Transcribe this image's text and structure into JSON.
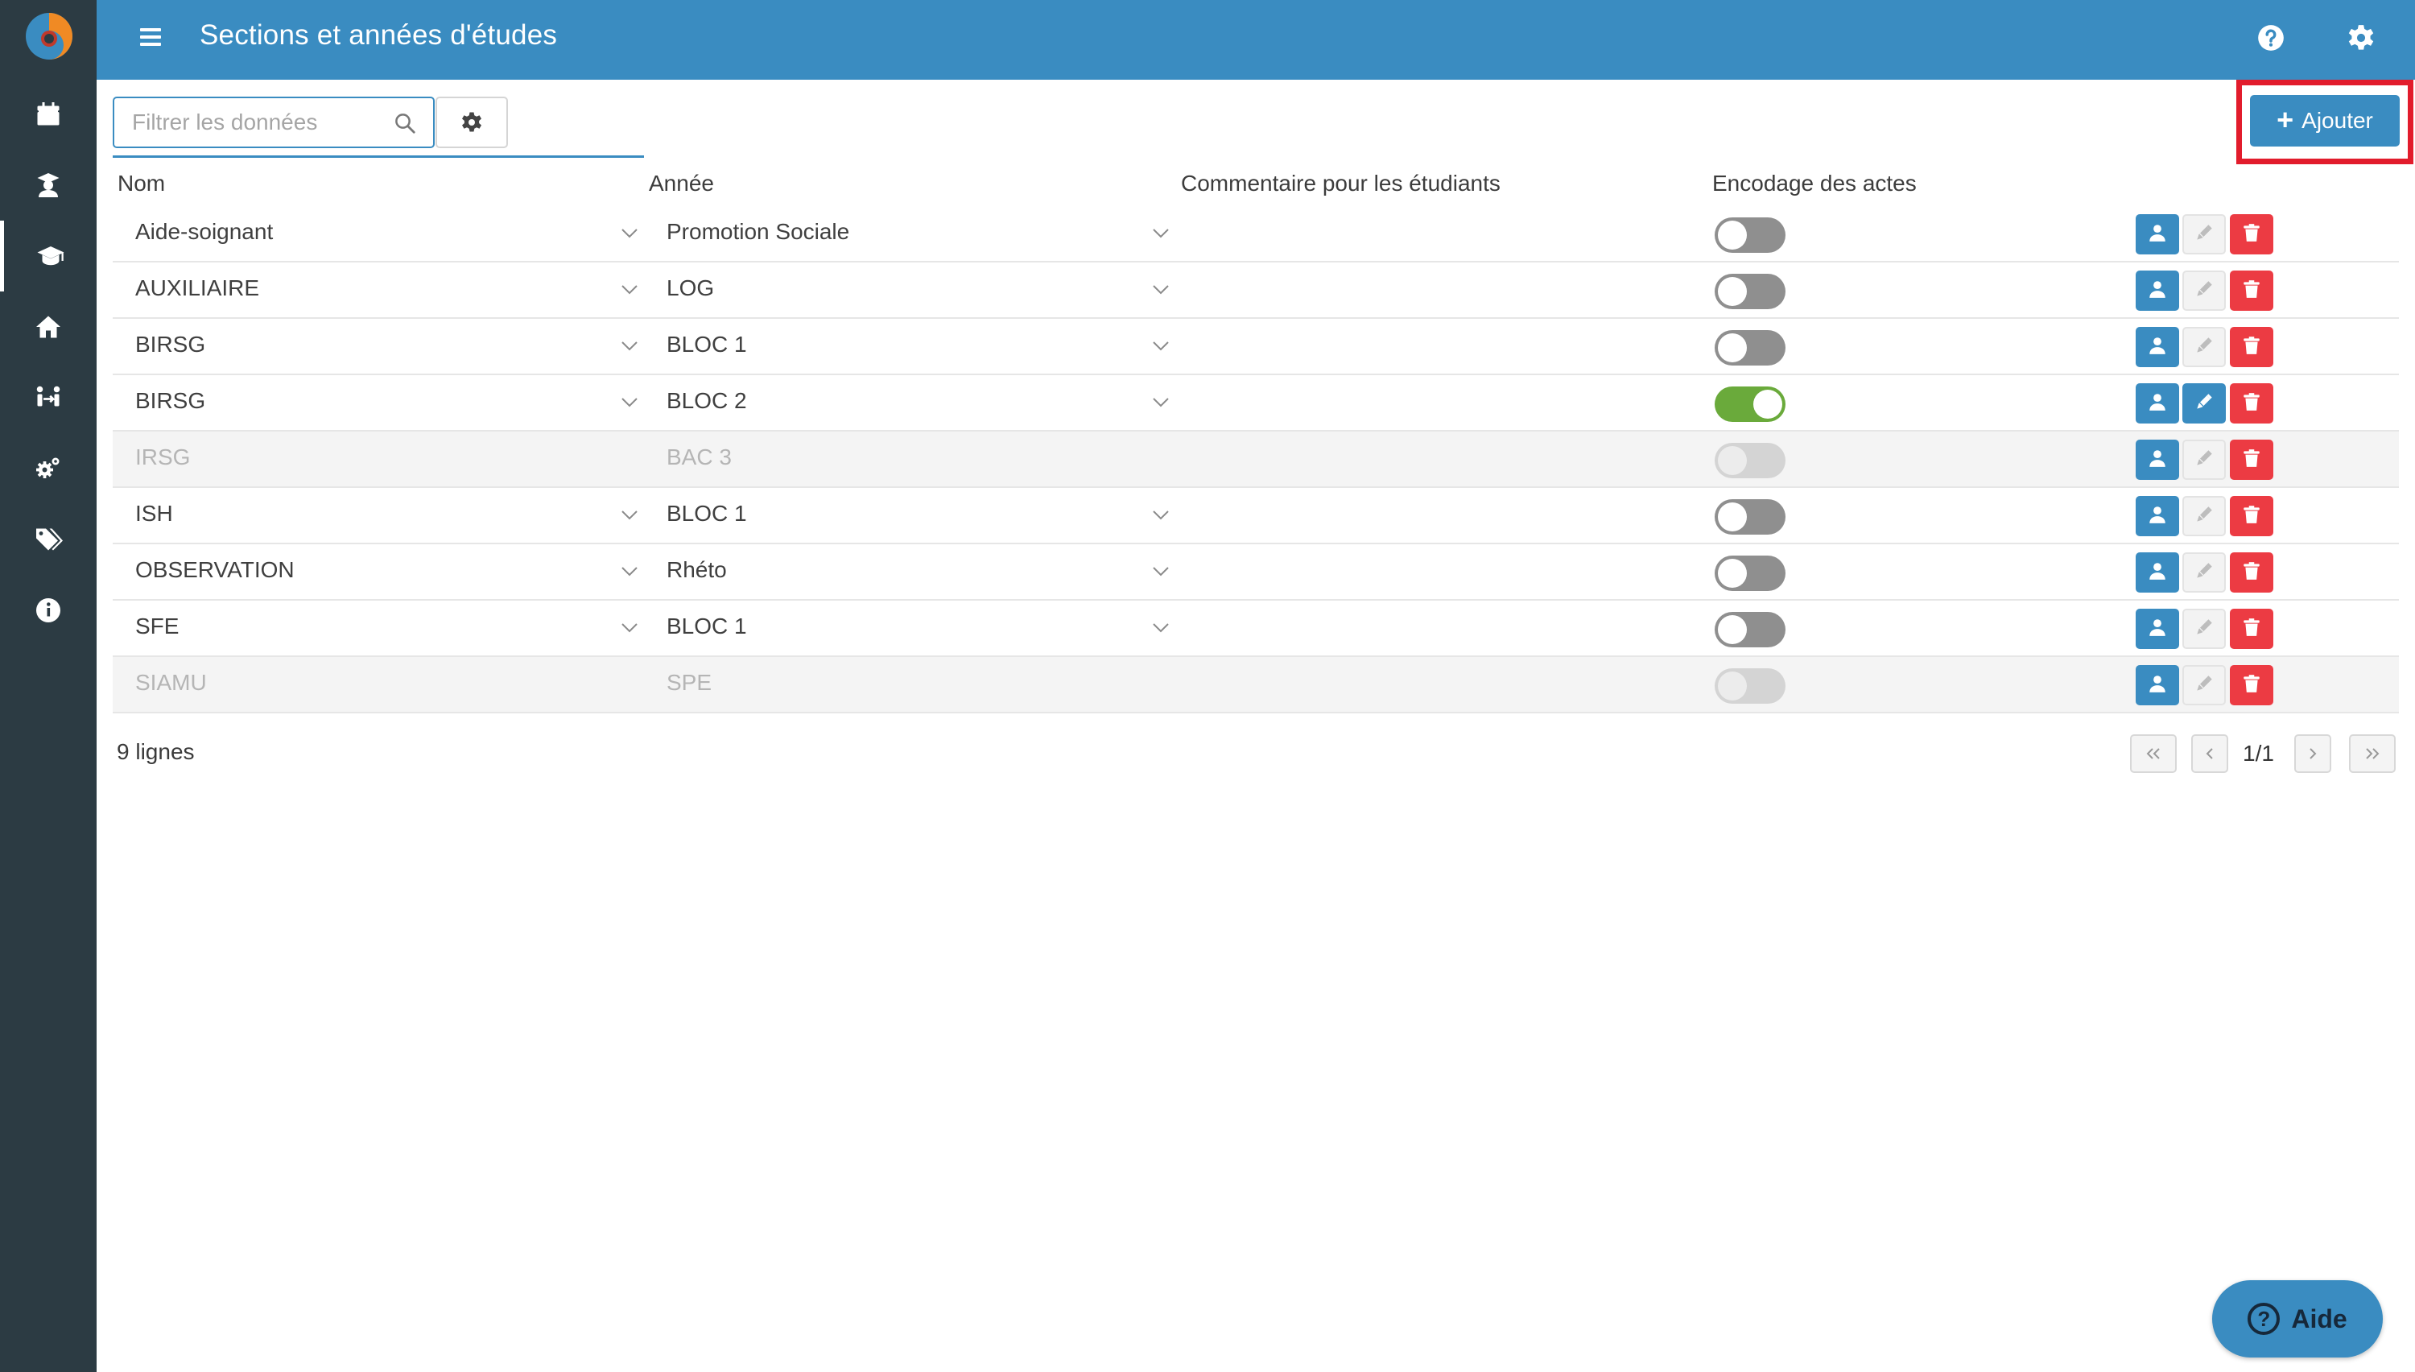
{
  "header": {
    "title": "Sections et années d'études",
    "icons": [
      "help-icon",
      "settings-icon"
    ]
  },
  "sidebar": {
    "items": [
      {
        "name": "calendar-icon",
        "active": false
      },
      {
        "name": "student-icon",
        "active": false
      },
      {
        "name": "graduation-cap-icon",
        "active": true
      },
      {
        "name": "home-icon",
        "active": false
      },
      {
        "name": "people-exchange-icon",
        "active": false
      },
      {
        "name": "cogs-icon",
        "active": false
      },
      {
        "name": "tags-icon",
        "active": false
      },
      {
        "name": "info-icon",
        "active": false
      }
    ]
  },
  "toolbar": {
    "search_placeholder": "Filtrer les données",
    "add_label": "Ajouter"
  },
  "table": {
    "columns": [
      "Nom",
      "Année",
      "Commentaire pour les étudiants",
      "Encodage des actes"
    ],
    "rows": [
      {
        "nom": "Aide-soignant",
        "annee": "Promotion Sociale",
        "commentaire": "",
        "encodage": false,
        "disabled": false
      },
      {
        "nom": "AUXILIAIRE",
        "annee": "LOG",
        "commentaire": "",
        "encodage": false,
        "disabled": false
      },
      {
        "nom": "BIRSG",
        "annee": "BLOC 1",
        "commentaire": "",
        "encodage": false,
        "disabled": false
      },
      {
        "nom": "BIRSG",
        "annee": "BLOC 2",
        "commentaire": "",
        "encodage": true,
        "disabled": false
      },
      {
        "nom": "IRSG",
        "annee": "BAC 3",
        "commentaire": "",
        "encodage": false,
        "disabled": true
      },
      {
        "nom": "ISH",
        "annee": "BLOC 1",
        "commentaire": "",
        "encodage": false,
        "disabled": false
      },
      {
        "nom": "OBSERVATION",
        "annee": "Rhéto",
        "commentaire": "",
        "encodage": false,
        "disabled": false
      },
      {
        "nom": "SFE",
        "annee": "BLOC 1",
        "commentaire": "",
        "encodage": false,
        "disabled": false
      },
      {
        "nom": "SIAMU",
        "annee": "SPE",
        "commentaire": "",
        "encodage": false,
        "disabled": true
      }
    ]
  },
  "footer": {
    "row_count": "9 lignes",
    "page_indicator": "1/1"
  },
  "help": {
    "label": "Aide"
  },
  "colors": {
    "primary": "#3a8cc1",
    "sidebar": "#2c3b43",
    "danger": "#ec3b43",
    "toggle_on": "#6aaa3b",
    "highlight": "#e21c2c"
  }
}
